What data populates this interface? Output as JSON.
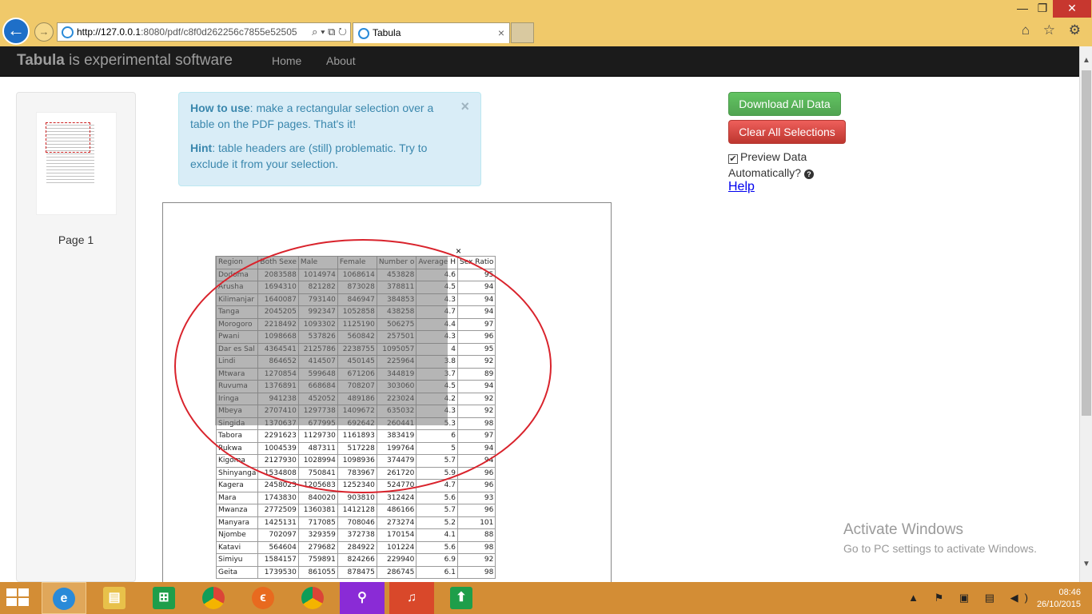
{
  "browser": {
    "url_host": "http://127.0.0.1",
    "url_rest": ":8080/pdf/c8f0d262256c7855e52505",
    "tab_title": "Tabula",
    "tab_close": "×",
    "addr_tools": "⌕ ▾ ⧉ ↻",
    "min": "—",
    "max": "❐",
    "close": "✕",
    "chrome_icons": "⌂ ☆ ⚙"
  },
  "navbar": {
    "brand_bold": "Tabula",
    "brand_rest": " is experimental software",
    "links": [
      "Home",
      "About"
    ]
  },
  "sidebar": {
    "page_label": "Page 1"
  },
  "alert": {
    "how_bold": "How to use",
    "how_text": ": make a rectangular selection over a table on the PDF pages. That's it!",
    "hint_bold": "Hint",
    "hint_text": ": table headers are (still) problematic. Try to exclude it from your selection.",
    "close": "×"
  },
  "pdf": {
    "selection_close": "×",
    "headers": [
      "Region",
      "Both Sexe",
      "Male",
      "Female",
      "Number o",
      "Average H",
      "Sex Ratio"
    ],
    "rows": [
      [
        "Dodoma",
        "2083588",
        "1014974",
        "1068614",
        "453828",
        "4.6",
        "95"
      ],
      [
        "Arusha",
        "1694310",
        "821282",
        "873028",
        "378811",
        "4.5",
        "94"
      ],
      [
        "Kilimanjar",
        "1640087",
        "793140",
        "846947",
        "384853",
        "4.3",
        "94"
      ],
      [
        "Tanga",
        "2045205",
        "992347",
        "1052858",
        "438258",
        "4.7",
        "94"
      ],
      [
        "Morogoro",
        "2218492",
        "1093302",
        "1125190",
        "506275",
        "4.4",
        "97"
      ],
      [
        "Pwani",
        "1098668",
        "537826",
        "560842",
        "257501",
        "4.3",
        "96"
      ],
      [
        "Dar es Sal",
        "4364541",
        "2125786",
        "2238755",
        "1095057",
        "4",
        "95"
      ],
      [
        "Lindi",
        "864652",
        "414507",
        "450145",
        "225964",
        "3.8",
        "92"
      ],
      [
        "Mtwara",
        "1270854",
        "599648",
        "671206",
        "344819",
        "3.7",
        "89"
      ],
      [
        "Ruvuma",
        "1376891",
        "668684",
        "708207",
        "303060",
        "4.5",
        "94"
      ],
      [
        "Iringa",
        "941238",
        "452052",
        "489186",
        "223024",
        "4.2",
        "92"
      ],
      [
        "Mbeya",
        "2707410",
        "1297738",
        "1409672",
        "635032",
        "4.3",
        "92"
      ],
      [
        "Singida",
        "1370637",
        "677995",
        "692642",
        "260441",
        "5.3",
        "98"
      ],
      [
        "Tabora",
        "2291623",
        "1129730",
        "1161893",
        "383419",
        "6",
        "97"
      ],
      [
        "Rukwa",
        "1004539",
        "487311",
        "517228",
        "199764",
        "5",
        "94"
      ],
      [
        "Kigoma",
        "2127930",
        "1028994",
        "1098936",
        "374479",
        "5.7",
        "94"
      ],
      [
        "Shinyanga",
        "1534808",
        "750841",
        "783967",
        "261720",
        "5.9",
        "96"
      ],
      [
        "Kagera",
        "2458023",
        "1205683",
        "1252340",
        "524770",
        "4.7",
        "96"
      ],
      [
        "Mara",
        "1743830",
        "840020",
        "903810",
        "312424",
        "5.6",
        "93"
      ],
      [
        "Mwanza",
        "2772509",
        "1360381",
        "1412128",
        "486166",
        "5.7",
        "96"
      ],
      [
        "Manyara",
        "1425131",
        "717085",
        "708046",
        "273274",
        "5.2",
        "101"
      ],
      [
        "Njombe",
        "702097",
        "329359",
        "372738",
        "170154",
        "4.1",
        "88"
      ],
      [
        "Katavi",
        "564604",
        "279682",
        "284922",
        "101224",
        "5.6",
        "98"
      ],
      [
        "Simiyu",
        "1584157",
        "759891",
        "824266",
        "229940",
        "6.9",
        "92"
      ],
      [
        "Geita",
        "1739530",
        "861055",
        "878475",
        "286745",
        "6.1",
        "98"
      ]
    ]
  },
  "controls": {
    "download_all": "Download All Data",
    "clear_all": "Clear All Selections",
    "preview_label": "Preview Data Automatically?",
    "preview_checked": "✔",
    "help": "Help"
  },
  "watermark": {
    "title": "Activate Windows",
    "subtitle": "Go to PC settings to activate Windows."
  },
  "taskbar": {
    "tray": "▲ ⚑ ▣ ▤ ◀)",
    "time": "08:46",
    "date": "26/10/2015",
    "icons": [
      "internet-explorer-icon",
      "file-explorer-icon",
      "store-icon",
      "chrome-icon",
      "firefox-icon",
      "chrome-icon",
      "search-app-icon",
      "music-app-icon",
      "acrobat-icon"
    ]
  }
}
